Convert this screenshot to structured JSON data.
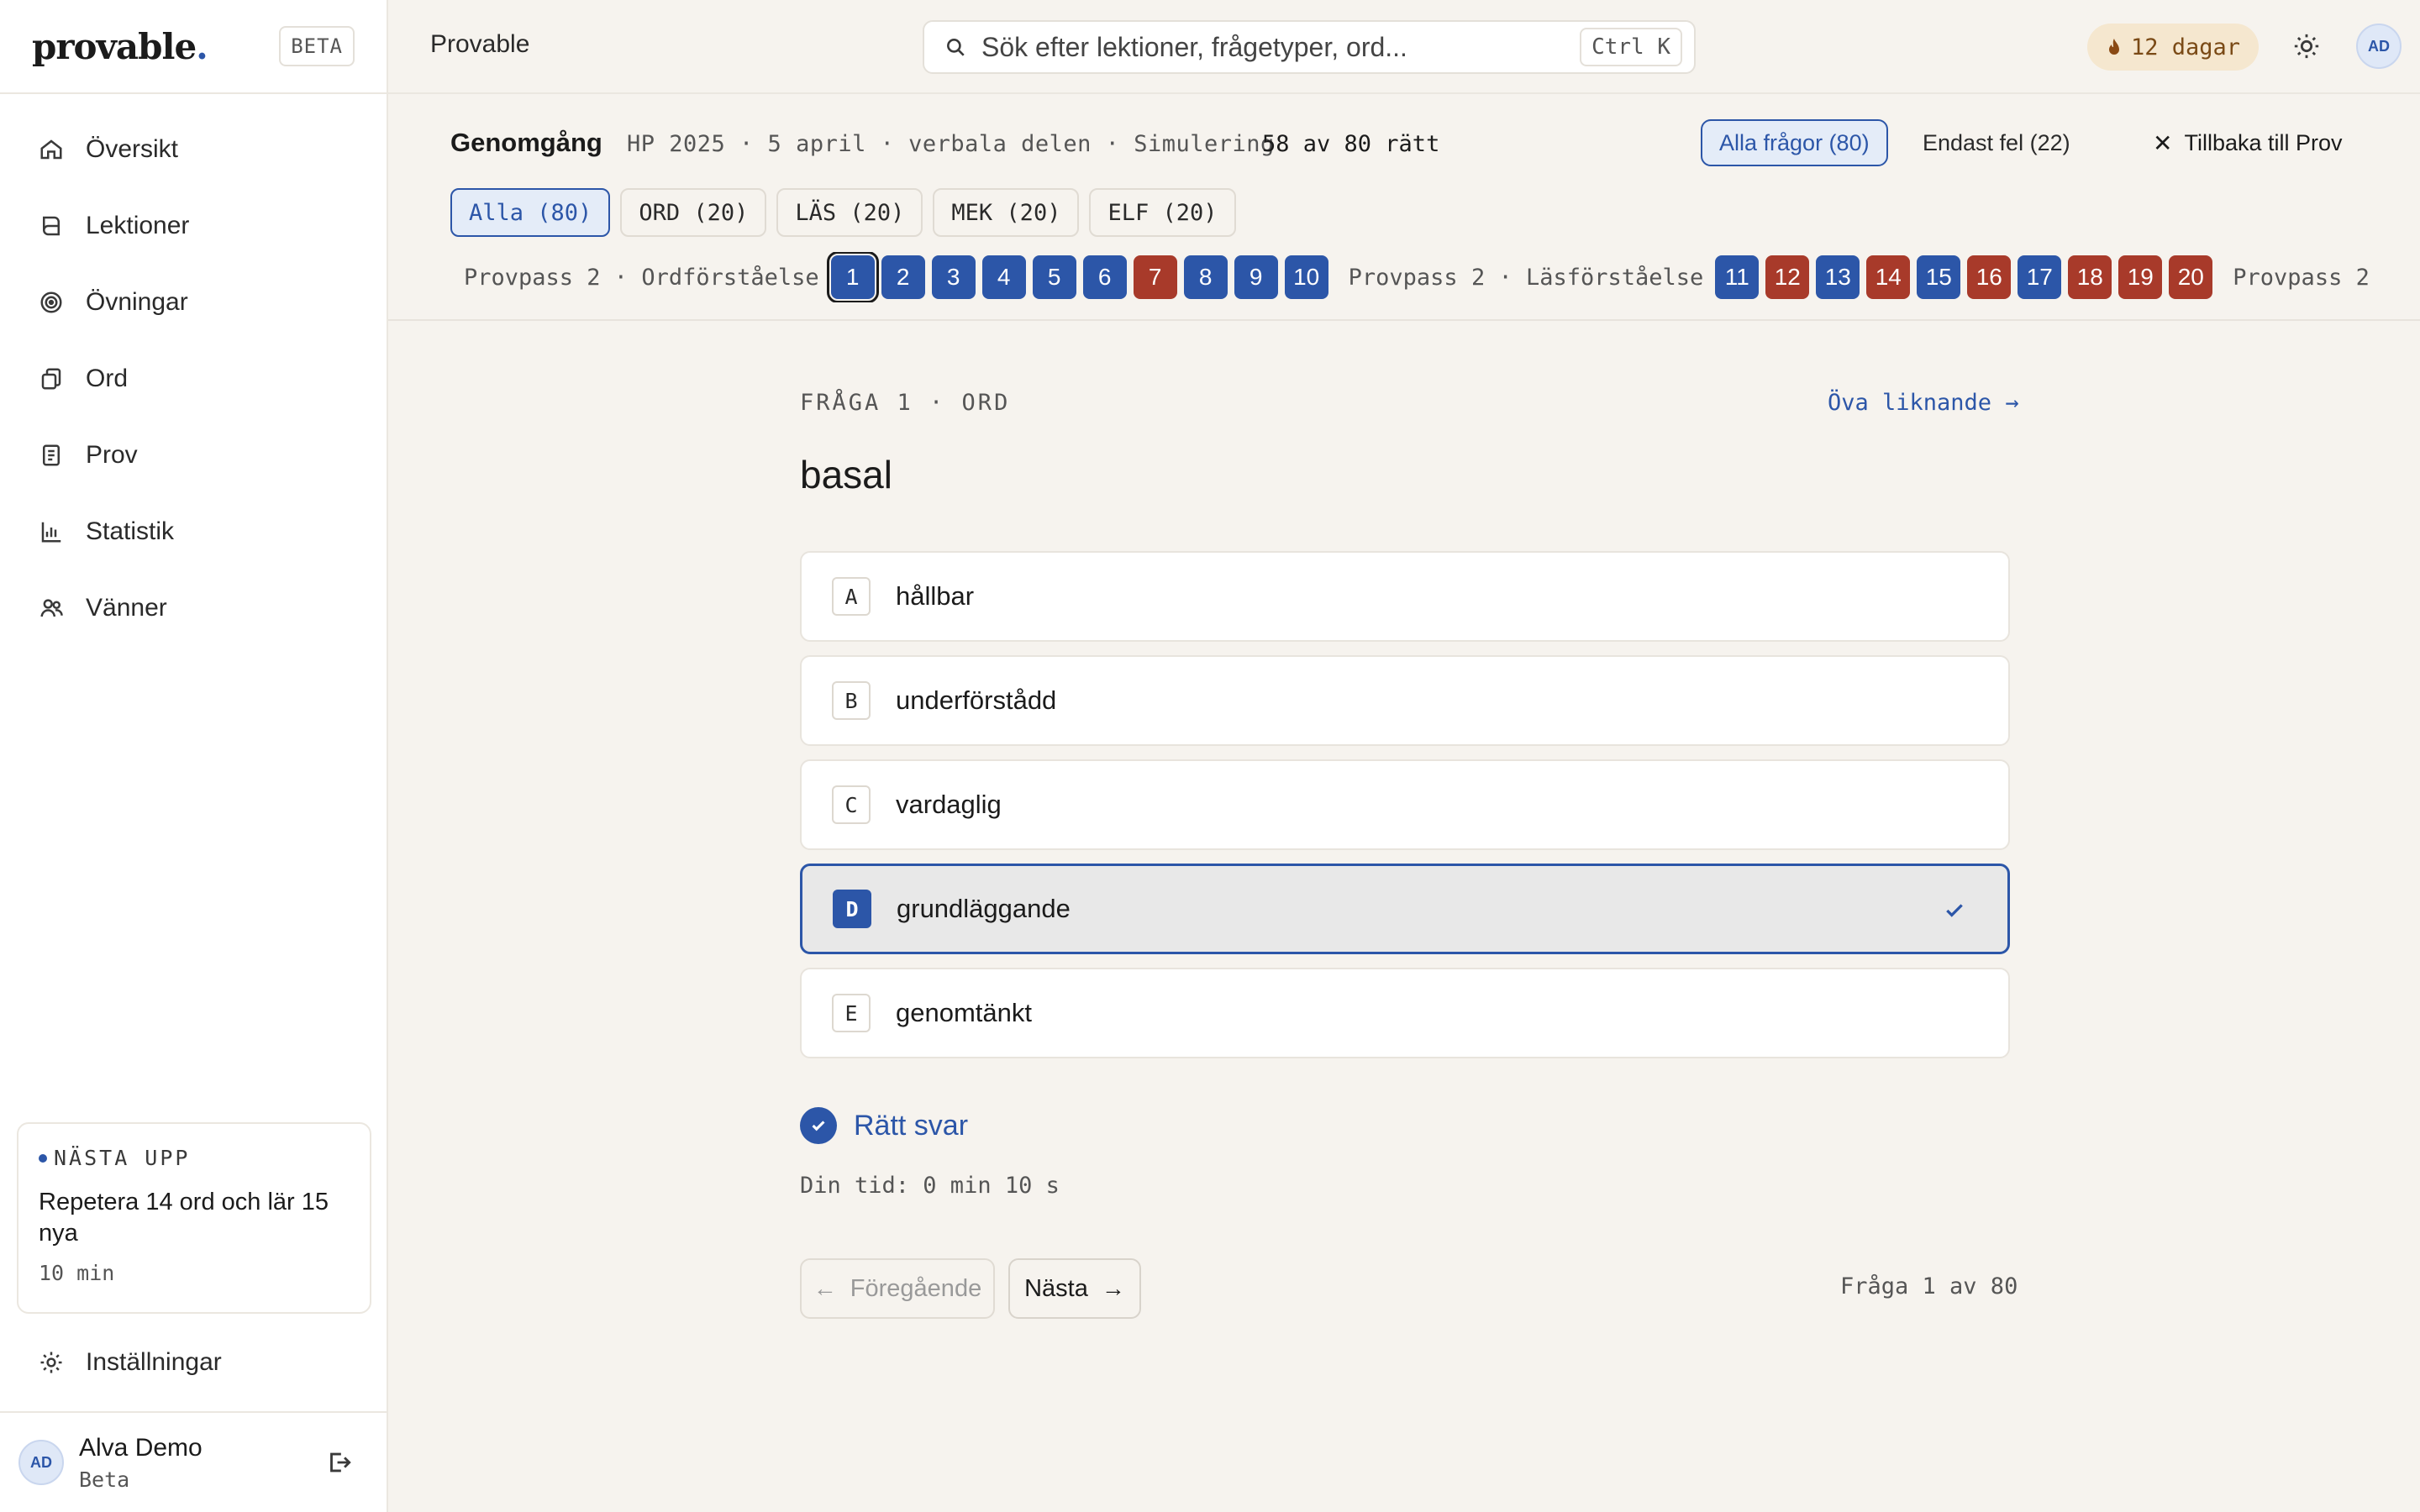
{
  "sidebar": {
    "logo": "provable",
    "logo_dot": ".",
    "beta_tag": "BETA",
    "nav": [
      {
        "label": "Översikt",
        "icon": "home-icon"
      },
      {
        "label": "Lektioner",
        "icon": "book-icon"
      },
      {
        "label": "Övningar",
        "icon": "target-icon"
      },
      {
        "label": "Ord",
        "icon": "cards-icon"
      },
      {
        "label": "Prov",
        "icon": "document-icon"
      },
      {
        "label": "Statistik",
        "icon": "bar-chart-icon"
      },
      {
        "label": "Vänner",
        "icon": "users-icon"
      }
    ],
    "next_up": {
      "label": "NÄSTA UPP",
      "title": "Repetera 14 ord och lär 15 nya",
      "duration": "10 min"
    },
    "settings_label": "Inställningar",
    "user": {
      "initials": "AD",
      "name": "Alva Demo",
      "plan": "Beta"
    }
  },
  "topbar": {
    "title": "Provable",
    "search_placeholder": "Sök efter lektioner, frågetyper, ord...",
    "shortcut": "Ctrl K",
    "streak": "12 dagar",
    "avatar_initials": "AD"
  },
  "review": {
    "title": "Genomgång",
    "meta": "HP 2025 · 5 april · verbala delen · Simulering",
    "score": "58 av 80 rätt",
    "filter_all": "Alla frågor (80)",
    "filter_errors": "Endast fel (22)",
    "back_label": "Tillbaka till Prov",
    "sections": [
      {
        "label": "Alla (80)",
        "active": true
      },
      {
        "label": "ORD (20)",
        "active": false
      },
      {
        "label": "LÄS (20)",
        "active": false
      },
      {
        "label": "MEK (20)",
        "active": false
      },
      {
        "label": "ELF (20)",
        "active": false
      }
    ],
    "groups": [
      {
        "label": "Provpass 2 · Ordförståelse",
        "questions": [
          {
            "n": "1",
            "status": "ok",
            "current": true
          },
          {
            "n": "2",
            "status": "ok"
          },
          {
            "n": "3",
            "status": "ok"
          },
          {
            "n": "4",
            "status": "ok"
          },
          {
            "n": "5",
            "status": "ok"
          },
          {
            "n": "6",
            "status": "ok"
          },
          {
            "n": "7",
            "status": "bad"
          },
          {
            "n": "8",
            "status": "ok"
          },
          {
            "n": "9",
            "status": "ok"
          },
          {
            "n": "10",
            "status": "ok"
          }
        ]
      },
      {
        "label": "Provpass 2 · Läsförståelse",
        "questions": [
          {
            "n": "11",
            "status": "ok"
          },
          {
            "n": "12",
            "status": "bad"
          },
          {
            "n": "13",
            "status": "ok"
          },
          {
            "n": "14",
            "status": "bad"
          },
          {
            "n": "15",
            "status": "ok"
          },
          {
            "n": "16",
            "status": "bad"
          },
          {
            "n": "17",
            "status": "ok"
          },
          {
            "n": "18",
            "status": "bad"
          },
          {
            "n": "19",
            "status": "bad"
          },
          {
            "n": "20",
            "status": "bad"
          }
        ]
      },
      {
        "label": "Provpass 2",
        "questions": []
      }
    ]
  },
  "question": {
    "tag": "FRÅGA 1 · ORD",
    "practice_similar": "Öva liknande →",
    "word": "basal",
    "options": [
      {
        "letter": "A",
        "text": "hållbar",
        "selected": false
      },
      {
        "letter": "B",
        "text": "underförstådd",
        "selected": false
      },
      {
        "letter": "C",
        "text": "vardaglig",
        "selected": false
      },
      {
        "letter": "D",
        "text": "grundläggande",
        "selected": true
      },
      {
        "letter": "E",
        "text": "genomtänkt",
        "selected": false
      }
    ],
    "result": "Rätt svar",
    "time": "Din tid: 0 min 10 s",
    "prev_label": "Föregående",
    "next_label": "Nästa",
    "counter": "Fråga 1 av 80"
  },
  "colors": {
    "accent": "#2c56a8",
    "wrong": "#a83a2a",
    "background": "#f6f3ee",
    "streak_bg": "#f5e7cf"
  }
}
